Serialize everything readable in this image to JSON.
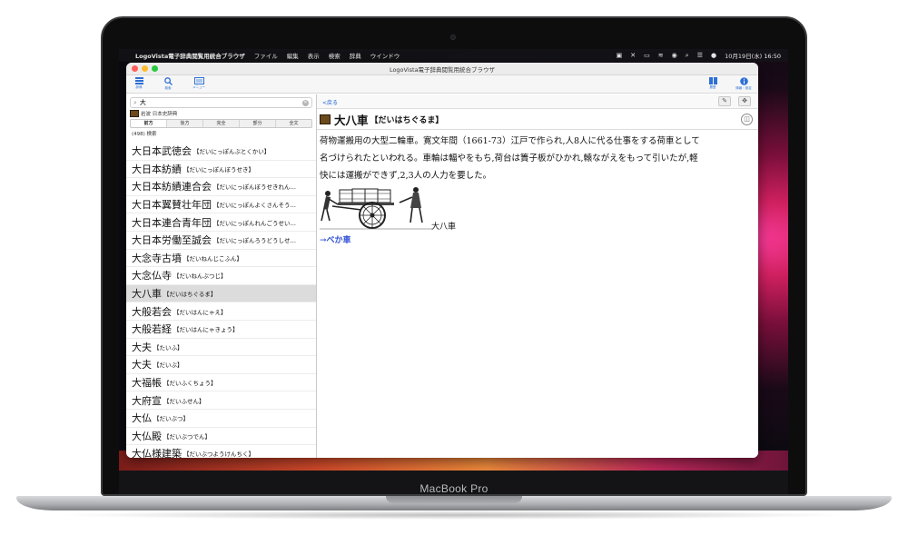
{
  "menubar": {
    "app_name": "LogoVista電子辞典閲覧用統合ブラウザ",
    "menus": [
      "ファイル",
      "編集",
      "表示",
      "検索",
      "辞典",
      "ウインドウ"
    ],
    "clock": "10月19日(水)  16:50"
  },
  "window": {
    "title": "LogoVista電子辞典閲覧用統合ブラウザ"
  },
  "toolbar": {
    "left_buttons": [
      {
        "label": "辞典",
        "icon": "list-icon"
      },
      {
        "label": "検索",
        "icon": "search-icon"
      },
      {
        "label": "メニュー",
        "icon": "menu-icon"
      }
    ],
    "right_buttons": [
      {
        "label": "履歴",
        "icon": "book-icon"
      },
      {
        "label": "情報・設定",
        "icon": "info-icon"
      }
    ]
  },
  "search": {
    "query": "大",
    "placeholder": ""
  },
  "dictionary": {
    "name": "岩波 日本史辞典"
  },
  "search_modes": [
    "前方",
    "後方",
    "完全",
    "部分",
    "全文"
  ],
  "active_mode": "前方",
  "result_count": "(498) 検索",
  "results": [
    {
      "headword": "大日本武徳会",
      "reading": "【だいにっぽんぶとくかい】"
    },
    {
      "headword": "大日本紡績",
      "reading": "【だいにっぽんぼうせき】"
    },
    {
      "headword": "大日本紡績連合会",
      "reading": "【だいにっぽんぼうせきれん…"
    },
    {
      "headword": "大日本翼賛壮年団",
      "reading": "【だいにっぽんよくさんそう…"
    },
    {
      "headword": "大日本連合青年団",
      "reading": "【だいにっぽんれんごうせい…"
    },
    {
      "headword": "大日本労働至誠会",
      "reading": "【だいにっぽんろうどうしせ…"
    },
    {
      "headword": "大念寺古墳",
      "reading": "【だいねんじこふん】"
    },
    {
      "headword": "大念仏寺",
      "reading": "【だいねんぶつじ】"
    },
    {
      "headword": "大八車",
      "reading": "【だいはちぐるま】"
    },
    {
      "headword": "大般若会",
      "reading": "【だいはんにゃえ】"
    },
    {
      "headword": "大般若経",
      "reading": "【だいはんにゃきょう】"
    },
    {
      "headword": "大夫",
      "reading": "【たいふ】"
    },
    {
      "headword": "大夫",
      "reading": "【だいぶ】"
    },
    {
      "headword": "大福帳",
      "reading": "【だいふくちょう】"
    },
    {
      "headword": "大府宣",
      "reading": "【だいふせん】"
    },
    {
      "headword": "大仏",
      "reading": "【だいぶつ】"
    },
    {
      "headword": "大仏殿",
      "reading": "【だいぶつでん】"
    },
    {
      "headword": "大仏様建築",
      "reading": "【だいぶつようけんちく】"
    }
  ],
  "selected_index": 8,
  "nav": {
    "back_label": "<戻る"
  },
  "entry": {
    "title": "大八車",
    "reading": "【だいはちぐるま】",
    "body_lines": [
      "荷物運搬用の大型二輪車。寛文年間（1661-73）江戸で作られ,人8人に代る仕事をする荷車として",
      "名づけられたといわれる。車輪は輻やをもち,荷台は簀子板がひかれ,轅ながえをもって引いたが,軽",
      "快には運搬ができず,2,3人の人力を要した。"
    ],
    "figure_caption": "大八車",
    "see_also": "→べか車"
  },
  "brand": "MacBook Pro",
  "colors": {
    "accent": "#1f63d6",
    "link": "#2f4fd6",
    "selected_row": "#dcdcdc"
  }
}
